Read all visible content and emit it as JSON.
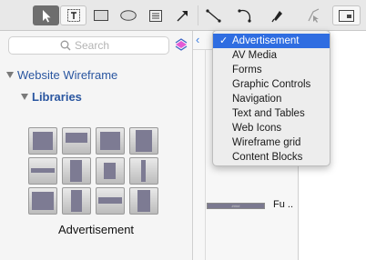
{
  "toolbar": {
    "tools": [
      {
        "name": "pointer-tool-button",
        "icon": "pointer-icon",
        "selected": true
      },
      {
        "name": "text-tool-button",
        "icon": "text-box-icon"
      },
      {
        "name": "rectangle-tool-button",
        "icon": "rectangle-icon"
      },
      {
        "name": "ellipse-tool-button",
        "icon": "ellipse-icon"
      },
      {
        "name": "note-tool-button",
        "icon": "note-icon"
      },
      {
        "name": "arrow-tool-button",
        "icon": "arrow-icon"
      },
      {
        "name": "line-tool-button",
        "icon": "line-icon"
      },
      {
        "name": "curve-tool-button",
        "icon": "curve-icon"
      },
      {
        "name": "pen-tool-button",
        "icon": "pen-icon"
      },
      {
        "name": "scissors-tool-button",
        "icon": "smart-connector-icon"
      },
      {
        "name": "frame-tool-button",
        "icon": "frame-icon"
      }
    ],
    "selected_color": "#6e6e6e"
  },
  "left_panel": {
    "search": {
      "placeholder": "Search",
      "value": ""
    },
    "tree": {
      "root_label": "Website Wireframe",
      "child_label": "Libraries"
    },
    "library_caption": "Advertisement",
    "accent": "#2a56a0"
  },
  "middle_panel": {
    "item_label": "Fu ..",
    "bar_caption": "####"
  },
  "dropdown": {
    "items": [
      {
        "label": "Advertisement",
        "checked": true
      },
      {
        "label": "AV Media"
      },
      {
        "label": "Forms"
      },
      {
        "label": "Graphic Controls"
      },
      {
        "label": "Navigation"
      },
      {
        "label": "Text and Tables"
      },
      {
        "label": "Web Icons"
      },
      {
        "label": "Wireframe grid"
      },
      {
        "label": "Content Blocks"
      }
    ],
    "check_glyph": "✓",
    "highlight_color": "#2f6de1"
  }
}
